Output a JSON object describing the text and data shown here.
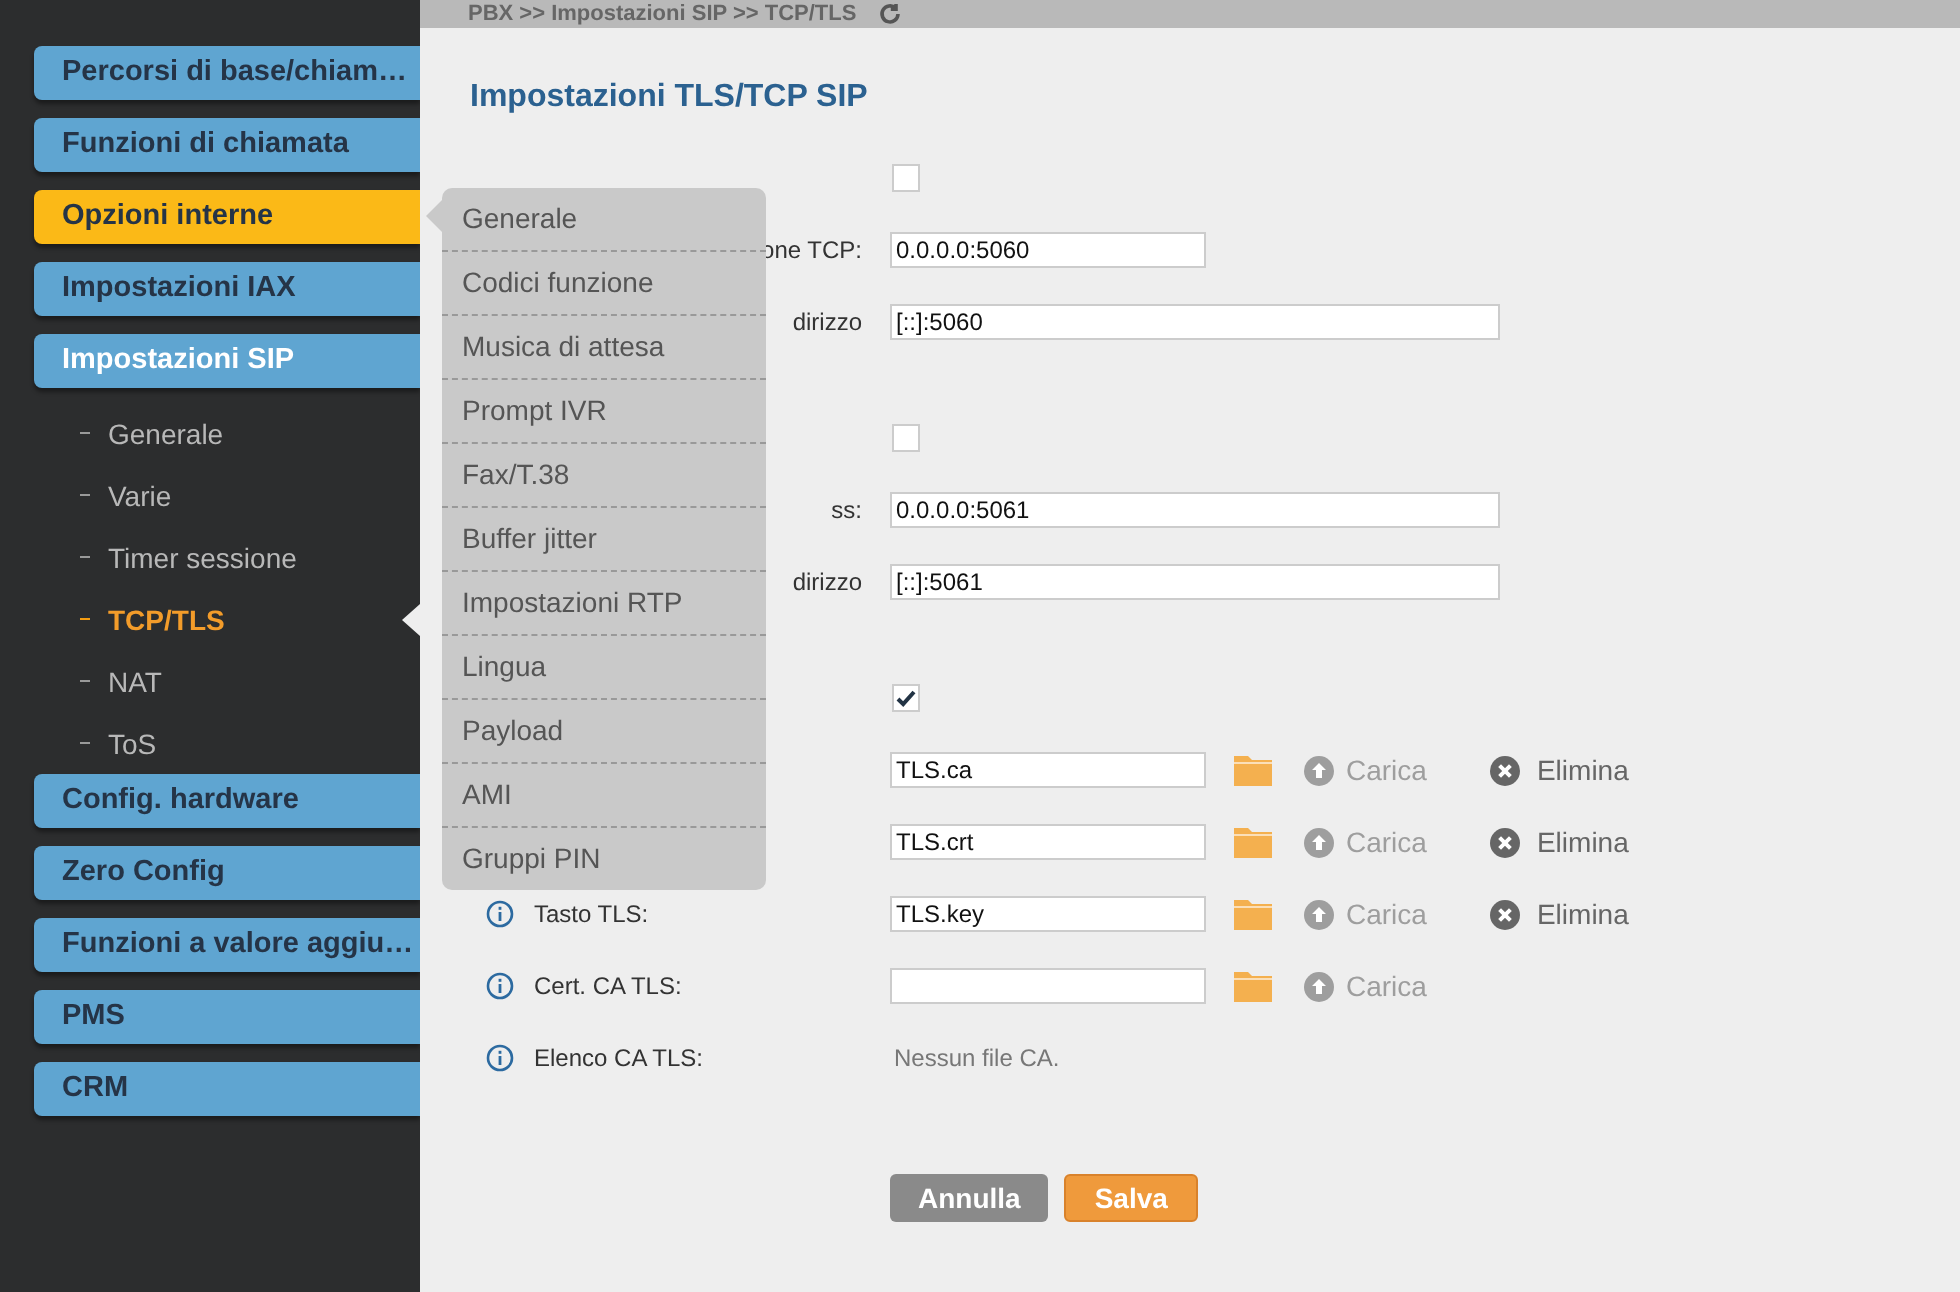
{
  "breadcrumb": "PBX >> Impostazioni SIP >> TCP/TLS",
  "sidebar": {
    "items": [
      {
        "label": "Percorsi di base/chiam…",
        "selected": false,
        "expanded": false
      },
      {
        "label": "Funzioni di chiamata",
        "selected": false,
        "expanded": false
      },
      {
        "label": "Opzioni interne",
        "selected": true,
        "expanded": false
      },
      {
        "label": "Impostazioni IAX",
        "selected": false,
        "expanded": false
      },
      {
        "label": "Impostazioni SIP",
        "selected": false,
        "expanded": true,
        "children": [
          {
            "label": "Generale",
            "selected": false
          },
          {
            "label": "Varie",
            "selected": false
          },
          {
            "label": "Timer sessione",
            "selected": false
          },
          {
            "label": "TCP/TLS",
            "selected": true
          },
          {
            "label": "NAT",
            "selected": false
          },
          {
            "label": "ToS",
            "selected": false
          }
        ]
      },
      {
        "label": "Config. hardware",
        "selected": false,
        "expanded": false
      },
      {
        "label": "Zero Config",
        "selected": false,
        "expanded": false
      },
      {
        "label": "Funzioni a valore aggiu…",
        "selected": false,
        "expanded": false
      },
      {
        "label": "PMS",
        "selected": false,
        "expanded": false
      },
      {
        "label": "CRM",
        "selected": false,
        "expanded": false
      }
    ]
  },
  "flyout_menu": {
    "items": [
      {
        "label": "Generale"
      },
      {
        "label": "Codici funzione"
      },
      {
        "label": "Musica di attesa"
      },
      {
        "label": "Prompt IVR"
      },
      {
        "label": "Fax/T.38"
      },
      {
        "label": "Buffer jitter"
      },
      {
        "label": "Impostazioni RTP"
      },
      {
        "label": "Lingua"
      },
      {
        "label": "Payload"
      },
      {
        "label": "AMI"
      },
      {
        "label": "Gruppi PIN"
      }
    ]
  },
  "title": "Impostazioni TLS/TCP SIP",
  "sections": [
    {
      "rows": [
        {
          "kind": "checkbox",
          "info": false,
          "checked": false
        },
        {
          "kind": "short-field",
          "info": false,
          "label": "one TCP:",
          "value": "0.0.0.0:5060"
        },
        {
          "kind": "long-field",
          "info": false,
          "label": "dirizzo",
          "value": "[::]:5060"
        }
      ]
    },
    {
      "rows": [
        {
          "kind": "checkbox",
          "info": false,
          "checked": false
        },
        {
          "kind": "long-field",
          "info": false,
          "label": "ss:",
          "value": "0.0.0.0:5061"
        },
        {
          "kind": "long-field",
          "info": false,
          "label": "dirizzo",
          "value": "[::]:5061"
        }
      ]
    },
    {
      "rows": [
        {
          "kind": "checkbox",
          "info": false,
          "checked": true
        },
        {
          "kind": "file",
          "info": false,
          "value": "TLS.ca",
          "upload": {
            "label": "Carica",
            "disabled": true
          },
          "delete": "Elimina"
        },
        {
          "kind": "file",
          "info": false,
          "value": "TLS.crt",
          "upload": {
            "label": "Carica",
            "disabled": true
          },
          "delete": "Elimina"
        },
        {
          "kind": "file",
          "info": true,
          "label": "Tasto TLS:",
          "value": "TLS.key",
          "upload": {
            "label": "Carica",
            "disabled": true
          },
          "delete": "Elimina"
        },
        {
          "kind": "file",
          "info": true,
          "label": "Cert. CA TLS:",
          "upload": {
            "label": "Carica",
            "disabled": true
          }
        },
        {
          "kind": "note",
          "info": true,
          "label": "Elenco CA TLS:",
          "value": "Nessun file CA."
        }
      ]
    }
  ],
  "buttons": [
    {
      "label": "Annulla",
      "kind": "cancel"
    },
    {
      "label": "Salva",
      "kind": "primary"
    }
  ]
}
